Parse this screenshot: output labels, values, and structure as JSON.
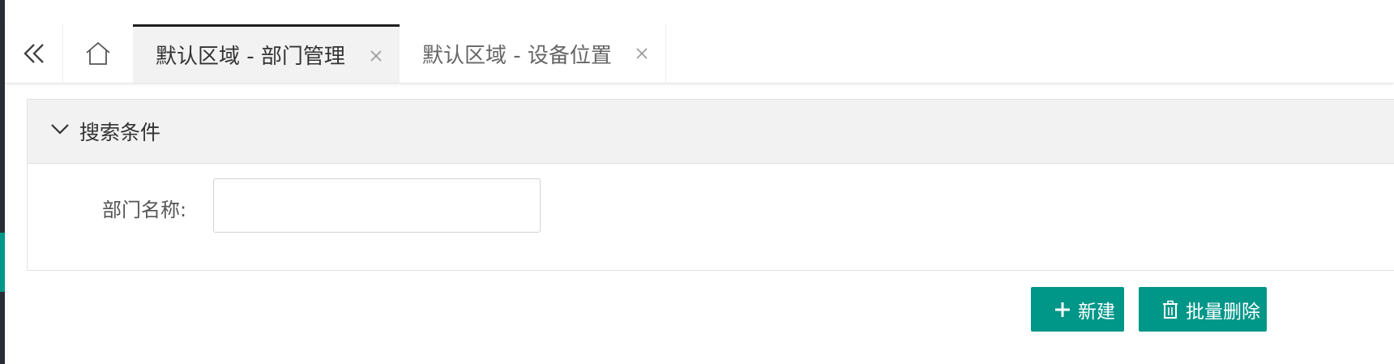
{
  "tabs": {
    "items": [
      {
        "label": "默认区域 - 部门管理",
        "active": true
      },
      {
        "label": "默认区域 - 设备位置",
        "active": false
      }
    ],
    "close_glyph": "×"
  },
  "search_panel": {
    "title": "搜索条件",
    "fields": [
      {
        "label": "部门名称:",
        "value": "",
        "placeholder": ""
      }
    ]
  },
  "toolbar": {
    "new_label": "新建",
    "batch_delete_label": "批量删除"
  },
  "colors": {
    "accent": "#009688",
    "active_tab_border": "#1f1f1f",
    "sidebar": "#2a2d34"
  },
  "icons": [
    "double-chevron-left-icon",
    "home-icon",
    "close-icon",
    "chevron-down-icon",
    "plus-icon",
    "trash-icon"
  ]
}
